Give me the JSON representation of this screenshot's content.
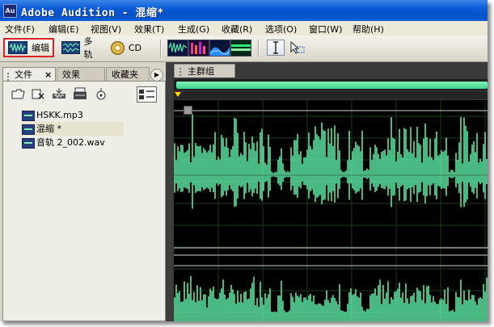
{
  "window": {
    "app_icon": "Au",
    "title": "Adobe Audition - 混缩*"
  },
  "menu": [
    "文件(F)",
    "编辑(E)",
    "视图(V)",
    "效果(T)",
    "生成(G)",
    "收藏(R)",
    "选项(O)",
    "窗口(W)",
    "帮助(H)"
  ],
  "toolbar": {
    "edit_label": "编辑",
    "multitrack_label": "多轨",
    "cd_label": "CD",
    "highlight_color": "#d9252a",
    "view_icons": [
      "waveform-view-icon",
      "spectral-frequency-icon",
      "spectral-pan-icon",
      "spectral-phase-icon"
    ],
    "tool_icons": [
      "ibeam-tool-icon",
      "marquee-tool-icon"
    ]
  },
  "left_panel": {
    "tabs": {
      "files": "文件",
      "files_close": "×",
      "effects": "效果",
      "favorites": "收藏夹"
    },
    "files": [
      {
        "name": "HSKK.mp3",
        "selected": false
      },
      {
        "name": "混缩 *",
        "selected": true
      },
      {
        "name": "音轨 2_002.wav",
        "selected": false
      }
    ]
  },
  "main_panel": {
    "tab_label": "主群组",
    "waveform_color": "#5ce6a4",
    "background": "#000000"
  }
}
